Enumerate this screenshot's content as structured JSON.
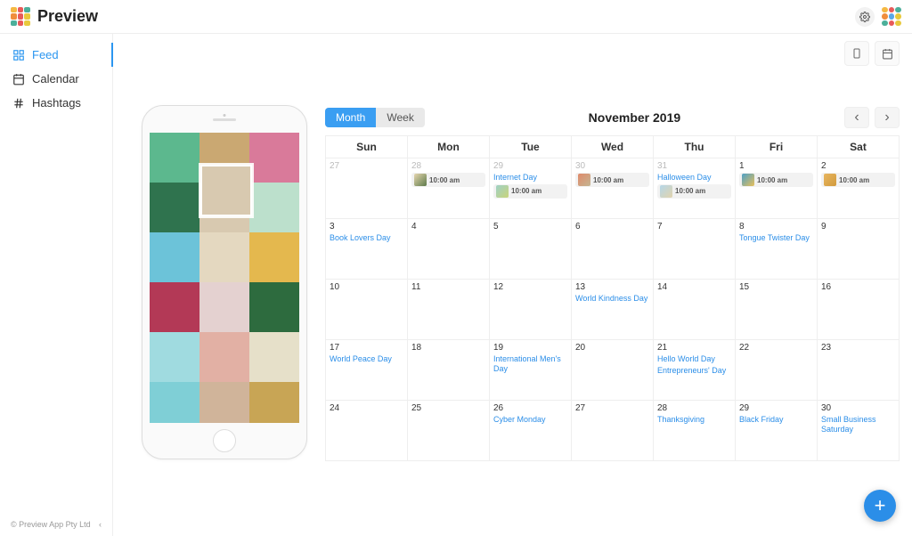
{
  "app": {
    "name": "Preview",
    "footer": "© Preview App Pty Ltd"
  },
  "sidebar": {
    "items": [
      {
        "label": "Feed",
        "active": true
      },
      {
        "label": "Calendar",
        "active": false
      },
      {
        "label": "Hashtags",
        "active": false
      }
    ]
  },
  "calendar": {
    "title": "November 2019",
    "views": {
      "month": "Month",
      "week": "Week",
      "active": "month"
    },
    "dayHeaders": [
      "Sun",
      "Mon",
      "Tue",
      "Wed",
      "Thu",
      "Fri",
      "Sat"
    ],
    "weeks": [
      [
        {
          "num": "27",
          "muted": true
        },
        {
          "num": "28",
          "muted": true,
          "posts": [
            {
              "time": "10:00 am",
              "colors": [
                "#e6d6af",
                "#5d7a4a"
              ]
            }
          ]
        },
        {
          "num": "29",
          "muted": true,
          "events": [
            "Internet Day"
          ],
          "posts": [
            {
              "time": "10:00 am",
              "colors": [
                "#9fd1c6",
                "#c9d47b"
              ]
            }
          ]
        },
        {
          "num": "30",
          "muted": true,
          "posts": [
            {
              "time": "10:00 am",
              "colors": [
                "#e08a6a",
                "#c4b693"
              ]
            }
          ]
        },
        {
          "num": "31",
          "muted": true,
          "events": [
            "Halloween Day"
          ],
          "posts": [
            {
              "time": "10:00 am",
              "colors": [
                "#b5d6e8",
                "#e2d4ad"
              ]
            }
          ]
        },
        {
          "num": "1",
          "posts": [
            {
              "time": "10:00 am",
              "colors": [
                "#4da0c7",
                "#e8c05a"
              ]
            }
          ]
        },
        {
          "num": "2",
          "posts": [
            {
              "time": "10:00 am",
              "colors": [
                "#e8b65f",
                "#d19a3d"
              ]
            }
          ]
        }
      ],
      [
        {
          "num": "3",
          "events": [
            "Book Lovers Day"
          ]
        },
        {
          "num": "4"
        },
        {
          "num": "5"
        },
        {
          "num": "6"
        },
        {
          "num": "7"
        },
        {
          "num": "8",
          "events": [
            "Tongue Twister Day"
          ]
        },
        {
          "num": "9"
        }
      ],
      [
        {
          "num": "10"
        },
        {
          "num": "11"
        },
        {
          "num": "12"
        },
        {
          "num": "13",
          "events": [
            "World Kindness Day"
          ]
        },
        {
          "num": "14"
        },
        {
          "num": "15"
        },
        {
          "num": "16"
        }
      ],
      [
        {
          "num": "17",
          "events": [
            "World Peace Day"
          ]
        },
        {
          "num": "18"
        },
        {
          "num": "19",
          "events": [
            "International Men's Day"
          ]
        },
        {
          "num": "20"
        },
        {
          "num": "21",
          "events": [
            "Hello World Day",
            "Entrepreneurs' Day"
          ]
        },
        {
          "num": "22"
        },
        {
          "num": "23"
        }
      ],
      [
        {
          "num": "24"
        },
        {
          "num": "25"
        },
        {
          "num": "26",
          "events": [
            "Cyber Monday"
          ]
        },
        {
          "num": "27"
        },
        {
          "num": "28",
          "events": [
            "Thanksgiving"
          ]
        },
        {
          "num": "29",
          "events": [
            "Black Friday"
          ]
        },
        {
          "num": "30",
          "events": [
            "Small Business Saturday"
          ]
        }
      ]
    ]
  },
  "phone_grid": [
    "#5cb88e",
    "#caa872",
    "#d97a9a",
    "#2f734e",
    "#d8c9b0",
    "#bce0cc",
    "#6cc3d9",
    "#e4d8c0",
    "#e4b84e",
    "#b33956",
    "#e4d1d0",
    "#2d6b3e",
    "#a0dbe0",
    "#e2b0a4",
    "#e6e0c9",
    "#7fcfd6",
    "#d0b49a",
    "#c8a555"
  ],
  "logo_colors": [
    "#f5b942",
    "#e85a5a",
    "#4caf9a",
    "#f08e3c",
    "#e85a5a",
    "#e8c93d",
    "#4caf9a",
    "#e85a5a",
    "#e8c93d"
  ],
  "avatar_colors": [
    "#f5b942",
    "#e85a5a",
    "#4caf9a",
    "#f08e3c",
    "#5aa7e8",
    "#e8c93d",
    "#4caf9a",
    "#e85a5a",
    "#e8c93d"
  ]
}
